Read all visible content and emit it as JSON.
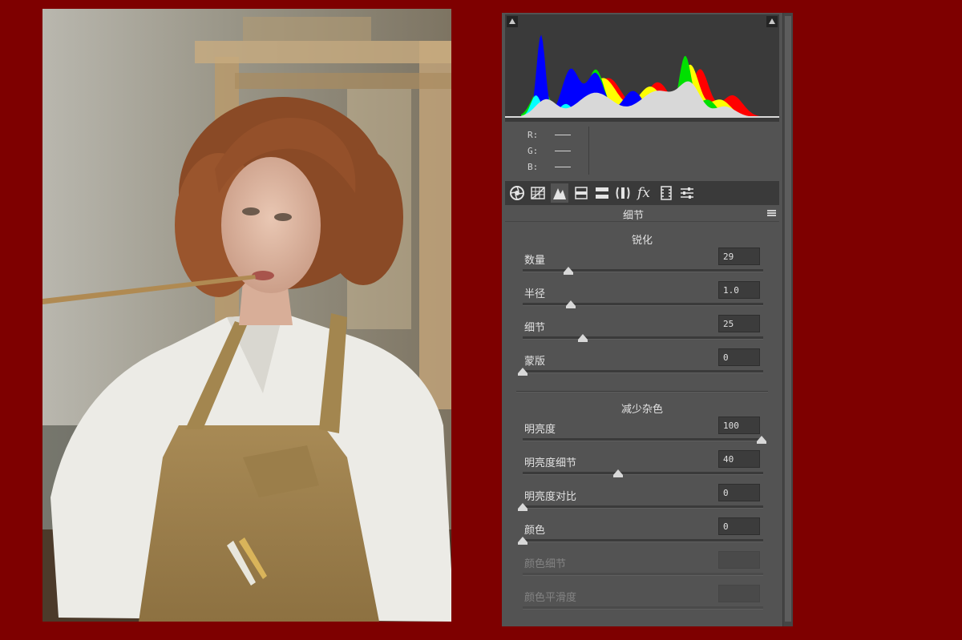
{
  "photo": {
    "alt_name": "portrait-photo"
  },
  "histogram": {
    "colors": {
      "red": "#ff0000",
      "green": "#00e000",
      "blue": "#0000ff",
      "yellow": "#ffff00",
      "cyan": "#00ffff",
      "magenta": "#ff00ff",
      "white": "#d8d8d8"
    }
  },
  "rgb_readout": {
    "r_label": "R:",
    "g_label": "G:",
    "b_label": "B:"
  },
  "tabs": [
    {
      "icon": "aperture-icon"
    },
    {
      "icon": "tone-curve-icon"
    },
    {
      "icon": "detail-icon"
    },
    {
      "icon": "hsl-icon"
    },
    {
      "icon": "split-toning-icon"
    },
    {
      "icon": "lens-corrections-icon"
    },
    {
      "icon": "effects-icon",
      "glyph": "fx"
    },
    {
      "icon": "camera-calibration-icon"
    },
    {
      "icon": "presets-icon"
    }
  ],
  "panel": {
    "title": "细节",
    "sharpening": {
      "title": "锐化",
      "sliders": [
        {
          "label": "数量",
          "value": "29",
          "position": 0.19,
          "disabled": false
        },
        {
          "label": "半径",
          "value": "1.0",
          "position": 0.2,
          "disabled": false
        },
        {
          "label": "细节",
          "value": "25",
          "position": 0.25,
          "disabled": false
        },
        {
          "label": "蒙版",
          "value": "0",
          "position": 0.0,
          "disabled": false
        }
      ]
    },
    "noise_reduction": {
      "title": "减少杂色",
      "sliders": [
        {
          "label": "明亮度",
          "value": "100",
          "position": 1.0,
          "disabled": false
        },
        {
          "label": "明亮度细节",
          "value": "40",
          "position": 0.4,
          "disabled": false
        },
        {
          "label": "明亮度对比",
          "value": "0",
          "position": 0.0,
          "disabled": false
        },
        {
          "label": "颜色",
          "value": "0",
          "position": 0.0,
          "disabled": false
        },
        {
          "label": "颜色细节",
          "value": "",
          "position": null,
          "disabled": true
        },
        {
          "label": "颜色平滑度",
          "value": "",
          "position": null,
          "disabled": true
        }
      ]
    }
  }
}
